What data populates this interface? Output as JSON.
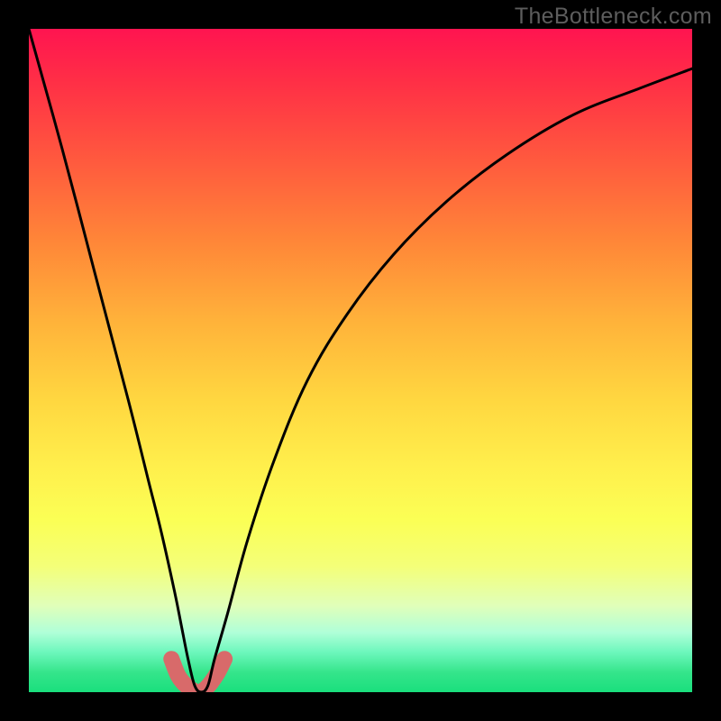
{
  "watermark": "TheBottleneck.com",
  "chart_data": {
    "type": "line",
    "title": "",
    "xlabel": "",
    "ylabel": "",
    "xlim": [
      0,
      100
    ],
    "ylim": [
      0,
      100
    ],
    "series": [
      {
        "name": "bottleneck-curve",
        "x": [
          0,
          5,
          10,
          15,
          18,
          20,
          22,
          23,
          24,
          25,
          26,
          27,
          28,
          30,
          33,
          37,
          42,
          48,
          55,
          63,
          72,
          82,
          92,
          100
        ],
        "values": [
          100,
          82,
          63,
          44,
          32,
          24,
          15,
          10,
          5,
          1,
          0,
          1,
          5,
          12,
          23,
          35,
          47,
          57,
          66,
          74,
          81,
          87,
          91,
          94
        ]
      },
      {
        "name": "highlight-bulb",
        "x": [
          21.5,
          22.5,
          23.5,
          24.5,
          25.5,
          26.5,
          27.5,
          28.5,
          29.5
        ],
        "values": [
          5.0,
          2.5,
          1.2,
          0.4,
          0.0,
          0.4,
          1.5,
          3.0,
          5.0
        ]
      }
    ],
    "colors": {
      "curve": "#000000",
      "highlight": "#d86a6a"
    }
  }
}
